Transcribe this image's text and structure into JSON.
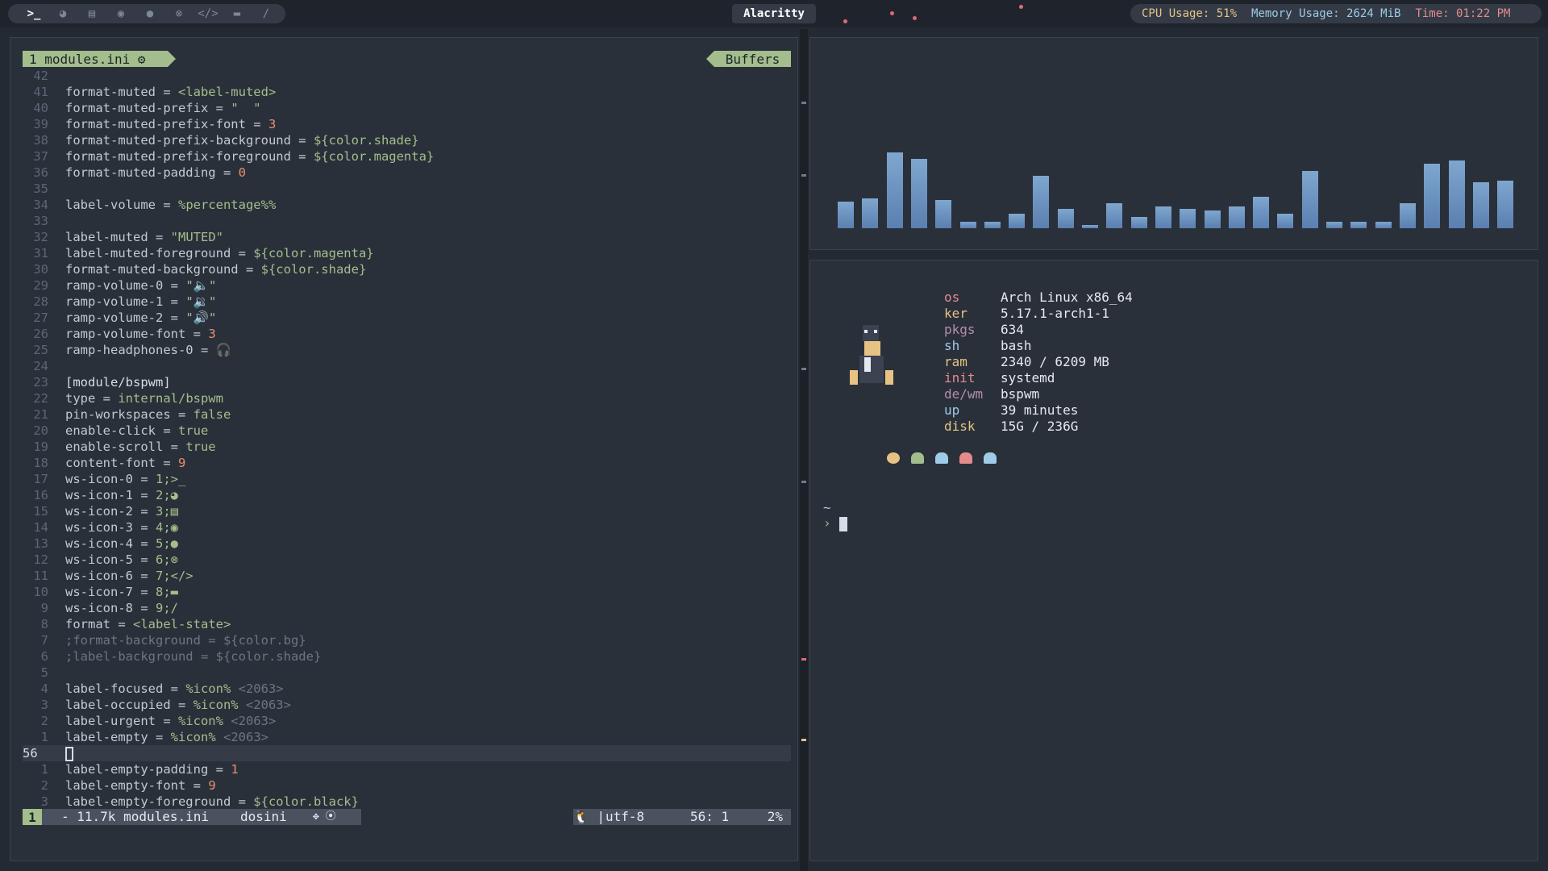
{
  "topbar": {
    "workspaces": [
      {
        "icon": "terminal-icon",
        "glyph": ">_",
        "active": true
      },
      {
        "icon": "firefox-icon",
        "glyph": "◕",
        "active": false
      },
      {
        "icon": "book-icon",
        "glyph": "▤",
        "active": false
      },
      {
        "icon": "chat-icon",
        "glyph": "◉",
        "active": false
      },
      {
        "icon": "spotify-icon",
        "glyph": "●",
        "active": false
      },
      {
        "icon": "gamepad-icon",
        "glyph": "⊗",
        "active": false
      },
      {
        "icon": "code-icon",
        "glyph": "</>",
        "active": false
      },
      {
        "icon": "folder-icon",
        "glyph": "▬",
        "active": false
      },
      {
        "icon": "brush-icon",
        "glyph": "∕",
        "active": false
      }
    ],
    "window_title": "Alacritty",
    "cpu": "CPU Usage: 51%",
    "memory": "Memory Usage: 2624 MiB",
    "time": "Time: 01:22 PM"
  },
  "editor": {
    "tab_label": "1 modules.ini ⚙",
    "buffers_label": "Buffers",
    "lines": [
      {
        "n": "42",
        "text": ""
      },
      {
        "n": "41",
        "text": "format-muted = <label-muted>"
      },
      {
        "n": "40",
        "text": "format-muted-prefix = \"  \""
      },
      {
        "n": "39",
        "text": "format-muted-prefix-font = 3"
      },
      {
        "n": "38",
        "text": "format-muted-prefix-background = ${color.shade}"
      },
      {
        "n": "37",
        "text": "format-muted-prefix-foreground = ${color.magenta}"
      },
      {
        "n": "36",
        "text": "format-muted-padding = 0"
      },
      {
        "n": "35",
        "text": ""
      },
      {
        "n": "34",
        "text": "label-volume = %percentage%%"
      },
      {
        "n": "33",
        "text": ""
      },
      {
        "n": "32",
        "text": "label-muted = \"MUTED\""
      },
      {
        "n": "31",
        "text": "label-muted-foreground = ${color.magenta}"
      },
      {
        "n": "30",
        "text": "format-muted-background = ${color.shade}"
      },
      {
        "n": "29",
        "text": "ramp-volume-0 = \"🔈\""
      },
      {
        "n": "28",
        "text": "ramp-volume-1 = \"🔉\""
      },
      {
        "n": "27",
        "text": "ramp-volume-2 = \"🔊\""
      },
      {
        "n": "26",
        "text": "ramp-volume-font = 3"
      },
      {
        "n": "25",
        "text": "ramp-headphones-0 = 🎧"
      },
      {
        "n": "24",
        "text": ""
      },
      {
        "n": "23",
        "text": "[module/bspwm]"
      },
      {
        "n": "22",
        "text": "type = internal/bspwm"
      },
      {
        "n": "21",
        "text": "pin-workspaces = false"
      },
      {
        "n": "20",
        "text": "enable-click = true"
      },
      {
        "n": "19",
        "text": "enable-scroll = true"
      },
      {
        "n": "18",
        "text": "content-font = 9"
      },
      {
        "n": "17",
        "text": "ws-icon-0 = 1;>_"
      },
      {
        "n": "16",
        "text": "ws-icon-1 = 2;◕"
      },
      {
        "n": "15",
        "text": "ws-icon-2 = 3;▤"
      },
      {
        "n": "14",
        "text": "ws-icon-3 = 4;◉"
      },
      {
        "n": "13",
        "text": "ws-icon-4 = 5;●"
      },
      {
        "n": "12",
        "text": "ws-icon-5 = 6;⊗"
      },
      {
        "n": "11",
        "text": "ws-icon-6 = 7;</>"
      },
      {
        "n": "10",
        "text": "ws-icon-7 = 8;▬"
      },
      {
        "n": "9",
        "text": "ws-icon-8 = 9;∕"
      },
      {
        "n": "8",
        "text": "format = <label-state>"
      },
      {
        "n": "7",
        "text": ";format-background = ${color.bg}"
      },
      {
        "n": "6",
        "text": ";label-background = ${color.shade}"
      },
      {
        "n": "5",
        "text": ""
      },
      {
        "n": "4",
        "text": "label-focused = %icon% <2063>"
      },
      {
        "n": "3",
        "text": "label-occupied = %icon% <2063>"
      },
      {
        "n": "2",
        "text": "label-urgent = %icon% <2063>"
      },
      {
        "n": "1",
        "text": "label-empty = %icon% <2063>"
      },
      {
        "n": "56",
        "text": ""
      },
      {
        "n": "1",
        "text": "label-empty-padding = 1"
      },
      {
        "n": "2",
        "text": "label-empty-font = 9"
      },
      {
        "n": "3",
        "text": "label-empty-foreground = ${color.black}"
      }
    ],
    "status": {
      "mode": "1",
      "file": "- 11.7k modules.ini",
      "filetype": "dosini",
      "glyphs": "✥ ⦿",
      "os": "🐧 |",
      "encoding": "utf-8",
      "position": "56:  1",
      "percent": "2%"
    }
  },
  "visualizer": {
    "bar_color": "#6d93c0",
    "levels": [
      0.17,
      0.19,
      0.48,
      0.44,
      0.18,
      0.04,
      0.04,
      0.09,
      0.33,
      0.12,
      0.02,
      0.16,
      0.07,
      0.14,
      0.12,
      0.11,
      0.14,
      0.2,
      0.09,
      0.36,
      0.04,
      0.04,
      0.04,
      0.16,
      0.41,
      0.43,
      0.29,
      0.3
    ]
  },
  "fetch": {
    "rows": [
      {
        "key": "os",
        "value": "Arch Linux x86_64",
        "cls": "k-os"
      },
      {
        "key": "ker",
        "value": "5.17.1-arch1-1",
        "cls": "k-ker"
      },
      {
        "key": "pkgs",
        "value": "634",
        "cls": "k-pkgs"
      },
      {
        "key": "sh",
        "value": "bash",
        "cls": "k-sh"
      },
      {
        "key": "ram",
        "value": "2340 / 6209 MB",
        "cls": "k-ram"
      },
      {
        "key": "init",
        "value": "systemd",
        "cls": "k-init"
      },
      {
        "key": "de/wm",
        "value": "bspwm",
        "cls": "k-dewm"
      },
      {
        "key": "up",
        "value": "39 minutes",
        "cls": "k-up"
      },
      {
        "key": "disk",
        "value": "15G / 236G",
        "cls": "k-disk"
      }
    ],
    "ghost_colors": [
      "#e6c384",
      "#a3be8c",
      "#9ecbe8",
      "#e58b8b",
      "#9ecbe8"
    ],
    "prompt_dir": "~",
    "prompt_symbol": "›"
  }
}
